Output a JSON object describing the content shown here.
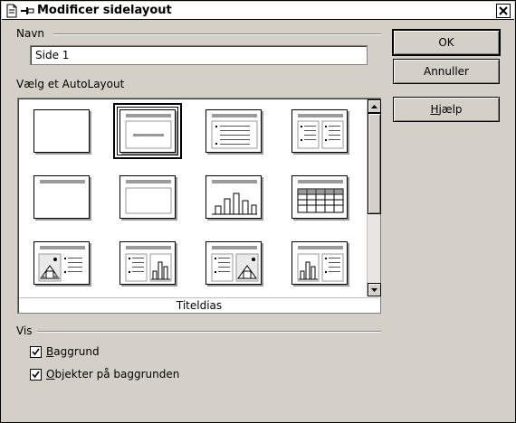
{
  "window": {
    "title": "Modificer sidelayout"
  },
  "name_section": {
    "label": "Navn",
    "value": "Side 1"
  },
  "layout_section": {
    "label": "Vælg et AutoLayout",
    "selected_caption": "Titeldias"
  },
  "buttons": {
    "ok": "OK",
    "cancel": "Annuller",
    "help_mnemonic": "H",
    "help_rest": "jælp"
  },
  "view_section": {
    "label": "Vis",
    "background": {
      "mnemonic": "B",
      "rest": "aggrund",
      "checked": true
    },
    "objects": {
      "mnemonic": "O",
      "rest": "bjekter på baggrunden",
      "checked": true
    }
  },
  "layouts": [
    {
      "icon": "blank-layout-icon"
    },
    {
      "icon": "title-slide-layout-icon",
      "selected": true
    },
    {
      "icon": "title-content-layout-icon"
    },
    {
      "icon": "title-2-content-layout-icon"
    },
    {
      "icon": "title-only-layout-icon"
    },
    {
      "icon": "centered-text-layout-icon"
    },
    {
      "icon": "title-chart-layout-icon"
    },
    {
      "icon": "title-table-layout-icon"
    },
    {
      "icon": "title-clipart-text-layout-icon"
    },
    {
      "icon": "title-text-chart-layout-icon"
    },
    {
      "icon": "title-text-clipart-layout-icon"
    },
    {
      "icon": "title-chart-text-layout-icon"
    }
  ]
}
